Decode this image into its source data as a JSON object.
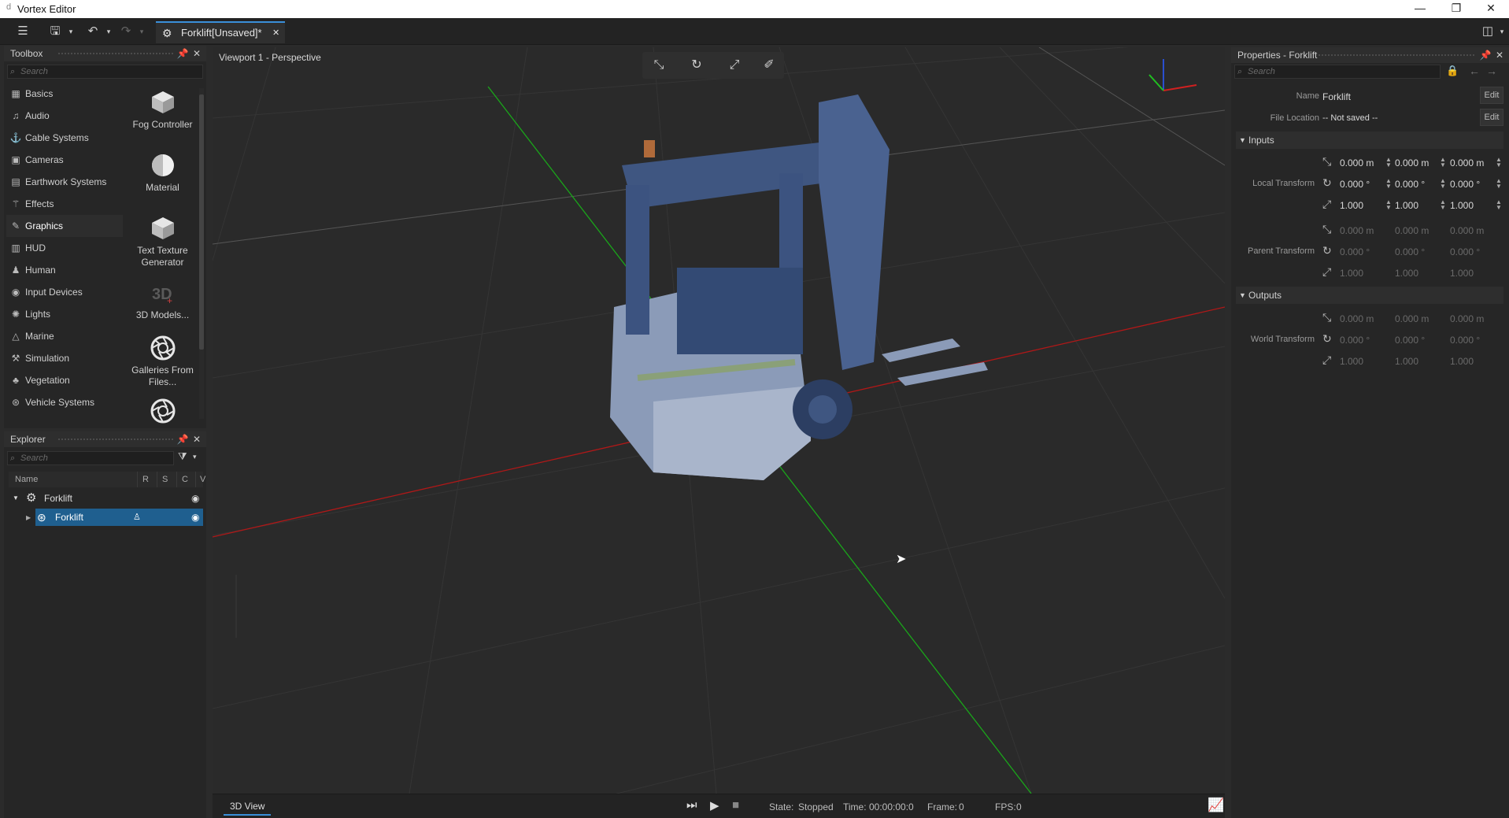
{
  "app": {
    "title": "Vortex Editor",
    "logo": "d"
  },
  "window_controls": {
    "minimize": "—",
    "restore": "❐",
    "close": "✕"
  },
  "toolbar": {
    "document_tab": "Forklift[Unsaved]*",
    "tab_close": "✕"
  },
  "toolbox": {
    "title": "Toolbox",
    "search_placeholder": "Search",
    "categories": [
      {
        "label": "Basics",
        "icon": "basics-icon"
      },
      {
        "label": "Audio",
        "icon": "music-note-icon"
      },
      {
        "label": "Cable Systems",
        "icon": "cable-icon"
      },
      {
        "label": "Cameras",
        "icon": "camera-icon"
      },
      {
        "label": "Earthwork Systems",
        "icon": "earthwork-icon"
      },
      {
        "label": "Effects",
        "icon": "wand-icon"
      },
      {
        "label": "Graphics",
        "icon": "brush-icon"
      },
      {
        "label": "HUD",
        "icon": "hud-icon"
      },
      {
        "label": "Human",
        "icon": "human-icon"
      },
      {
        "label": "Input Devices",
        "icon": "input-device-icon"
      },
      {
        "label": "Lights",
        "icon": "light-icon"
      },
      {
        "label": "Marine",
        "icon": "marine-icon"
      },
      {
        "label": "Simulation",
        "icon": "simulation-icon"
      },
      {
        "label": "Vegetation",
        "icon": "vegetation-icon"
      },
      {
        "label": "Vehicle Systems",
        "icon": "vehicle-icon"
      }
    ],
    "items": [
      {
        "label": "Fog Controller",
        "icon": "cube-icon"
      },
      {
        "label": "Material",
        "icon": "material-sphere-icon"
      },
      {
        "label": "Text Texture Generator",
        "icon": "cube-icon"
      },
      {
        "label": "3D Models...",
        "icon": "3d-models-icon"
      },
      {
        "label": "Galleries From Files...",
        "icon": "aperture-icon"
      }
    ]
  },
  "explorer": {
    "title": "Explorer",
    "search_placeholder": "Search",
    "columns": [
      "Name",
      "R",
      "S",
      "C",
      "V"
    ],
    "rows": [
      {
        "label": "Forklift",
        "expanded": true
      },
      {
        "label": "Forklift",
        "selected": true
      }
    ]
  },
  "viewport": {
    "title": "Viewport 1 - Perspective",
    "tab": "3D View",
    "tools": [
      "move-icon",
      "rotate-icon",
      "scale-icon",
      "ruler-icon"
    ]
  },
  "status": {
    "state_label": "State:",
    "state_value": "Stopped",
    "time_label": "Time:",
    "time_value": "00:00:00:0",
    "frame_label": "Frame:",
    "frame_value": "0",
    "fps_label": "FPS:",
    "fps_value": "0"
  },
  "properties": {
    "title": "Properties - Forklift",
    "search_placeholder": "Search",
    "name_label": "Name",
    "name_value": "Forklift",
    "file_label": "File Location",
    "file_value": "-- Not saved --",
    "edit_label": "Edit",
    "inputs_title": "Inputs",
    "outputs_title": "Outputs",
    "local_transform": "Local Transform",
    "parent_transform": "Parent Transform",
    "world_transform": "World Transform",
    "pos": [
      "0.000 m",
      "0.000 m",
      "0.000 m"
    ],
    "rot": [
      "0.000 °",
      "0.000 °",
      "0.000 °"
    ],
    "scl": [
      "1.000",
      "1.000",
      "1.000"
    ]
  }
}
